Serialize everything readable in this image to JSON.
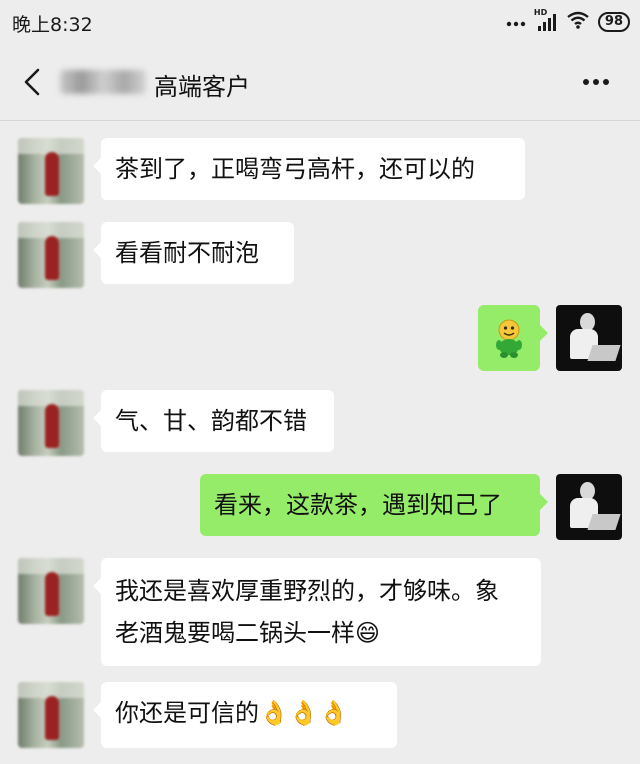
{
  "status_bar": {
    "time": "晚上8:32",
    "signal_label": "HD",
    "battery": "98"
  },
  "header": {
    "title": "高端客户",
    "back_icon": "chevron-left-icon",
    "more_icon": "more-dots-icon"
  },
  "messages": [
    {
      "side": "left",
      "text": "茶到了，正喝弯弓高杆，还可以的"
    },
    {
      "side": "left",
      "text": "看看耐不耐泡"
    },
    {
      "side": "right",
      "type": "sticker",
      "sticker": "smiling-figure-emoji"
    },
    {
      "side": "left",
      "text": "气、甘、韵都不错"
    },
    {
      "side": "right",
      "text": "看来，这款茶，遇到知己了"
    },
    {
      "side": "left",
      "line1": "我还是喜欢厚重野烈的，才够味。象",
      "line2": "老酒鬼要喝二锅头一样😄"
    },
    {
      "side": "left",
      "text": "你还是可信的👌👌👌"
    }
  ]
}
